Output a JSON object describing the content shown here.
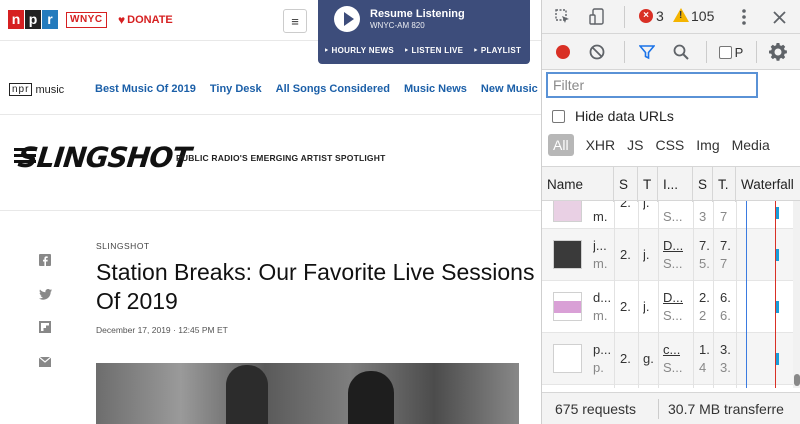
{
  "site": {
    "logo_letters": [
      "n",
      "p",
      "r"
    ],
    "station": "WNYC",
    "donate": "DONATE",
    "menu_icon": "≡"
  },
  "player": {
    "title": "Resume Listening",
    "subtitle": "WNYC-AM 820",
    "links": [
      "HOURLY NEWS",
      "LISTEN LIVE",
      "PLAYLIST"
    ]
  },
  "music_nav": {
    "brand_box": "npr",
    "brand_text": "music",
    "links": [
      "Best Music Of 2019",
      "Tiny Desk",
      "All Songs Considered",
      "Music News",
      "New Music"
    ]
  },
  "slingshot": {
    "logo": "SLINGSHOT",
    "tagline": "PUBLIC RADIO'S EMERGING ARTIST SPOTLIGHT"
  },
  "social": [
    "facebook-icon",
    "twitter-icon",
    "flipboard-icon",
    "email-icon"
  ],
  "article": {
    "kicker": "SLINGSHOT",
    "title": "Station Breaks: Our Favorite Live Sessions Of 2019",
    "date": "December 17, 2019 · 12:45 PM ET"
  },
  "devtools": {
    "error_count": "3",
    "warning_count": "105",
    "filter_placeholder": "Filter",
    "hide_data_urls": "Hide data URLs",
    "types": [
      "All",
      "XHR",
      "JS",
      "CSS",
      "Img",
      "Media"
    ],
    "columns": [
      "Name",
      "S",
      "T",
      "I...",
      "S",
      "T.",
      "Waterfall"
    ],
    "rows": [
      {
        "name": "",
        "name_sub": "m.",
        "c1": "2.",
        "c2": "j.",
        "c3": "",
        "c3_sub": "S...",
        "c4": "",
        "c4_sub": "3",
        "c5": "",
        "c5_sub": "7",
        "thumb": "pink"
      },
      {
        "name": "j...",
        "name_sub": "m.",
        "c1": "2.",
        "c2": "j.",
        "c3": "D...",
        "c3_sub": "S...",
        "c4": "7.",
        "c4_sub": "5.",
        "c5": "7.",
        "c5_sub": "7",
        "thumb": "dark"
      },
      {
        "name": "d...",
        "name_sub": "m.",
        "c1": "2.",
        "c2": "j.",
        "c3": "D...",
        "c3_sub": "S...",
        "c4": "2.",
        "c4_sub": "2",
        "c5": "6.",
        "c5_sub": "6.",
        "thumb": "pink"
      },
      {
        "name": "p...",
        "name_sub": "p.",
        "c1": "2.",
        "c2": "g.",
        "c3": "c...",
        "c3_sub": "S...",
        "c4": "1.",
        "c4_sub": "4",
        "c5": "3.",
        "c5_sub": "3.",
        "thumb": "blank"
      }
    ],
    "requests": "675 requests",
    "transferred": "30.7 MB transferre"
  }
}
